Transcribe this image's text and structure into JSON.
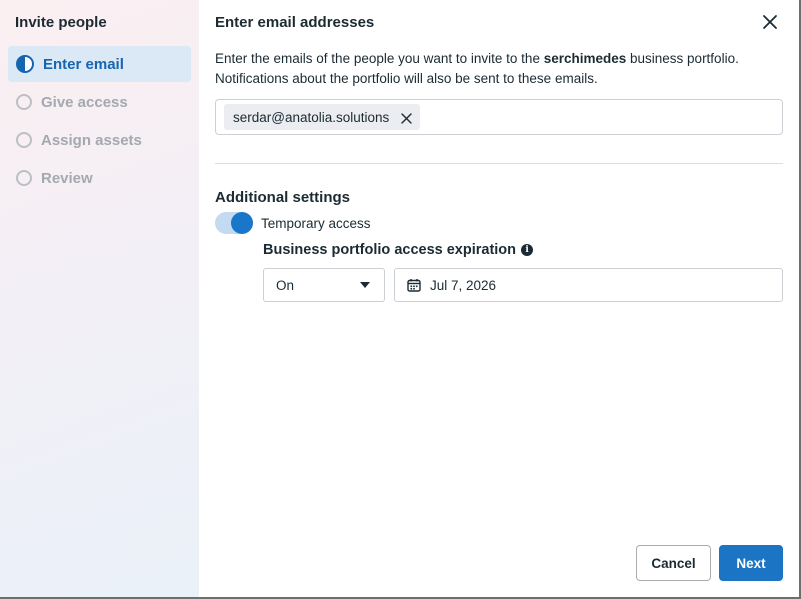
{
  "sidebar": {
    "title": "Invite people",
    "steps": [
      {
        "label": "Enter email",
        "state": "active"
      },
      {
        "label": "Give access",
        "state": "pending"
      },
      {
        "label": "Assign assets",
        "state": "pending"
      },
      {
        "label": "Review",
        "state": "pending"
      }
    ]
  },
  "header": {
    "title": "Enter email addresses",
    "close_icon": "close-icon"
  },
  "description": {
    "prefix": "Enter the emails of the people you want to invite to the ",
    "portfolio_name": "serchimedes",
    "suffix": " business portfolio.",
    "line2": "Notifications about the portfolio will also be sent to these emails."
  },
  "emails": {
    "chips": [
      "serdar@anatolia.solutions"
    ]
  },
  "additional_settings": {
    "title": "Additional settings",
    "temporary_access": {
      "label": "Temporary access",
      "enabled": true
    },
    "expiration": {
      "title": "Business portfolio access expiration",
      "mode": "On",
      "date": "Jul 7, 2026"
    }
  },
  "footer": {
    "cancel_label": "Cancel",
    "next_label": "Next"
  },
  "colors": {
    "accent": "#1b74c4",
    "active_step_bg": "#dbe8f5",
    "text": "#1c2b33"
  }
}
